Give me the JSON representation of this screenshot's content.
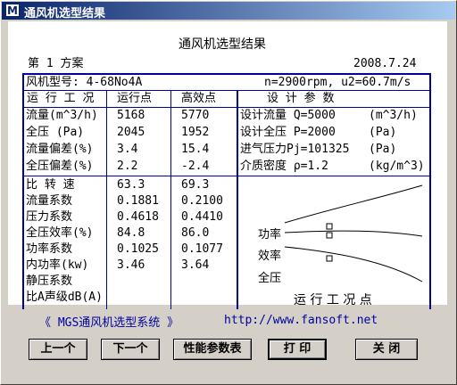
{
  "window": {
    "title": "通风机选型结果"
  },
  "report": {
    "heading": "通风机选型结果",
    "plan": "第 1 方案",
    "date": "2008.7.24",
    "fan_model": "风机型号: 4-68No4A",
    "speed_info": "n=2900rpm, u2=60.7m/s"
  },
  "table": {
    "headers": {
      "condition": "运 行 工 况",
      "operating": "运行点",
      "efficient": "高效点",
      "design": "设 计 参 数"
    },
    "rows1": [
      {
        "label": "流量(m^3/h)",
        "op": "5168",
        "eff": "5770"
      },
      {
        "label": "全压 (Pa)",
        "op": "2045",
        "eff": "1952"
      },
      {
        "label": "流量偏差(%)",
        "op": "3.4",
        "eff": "15.4"
      },
      {
        "label": "全压偏差(%)",
        "op": "2.2",
        "eff": "-2.4"
      }
    ],
    "design_params": [
      {
        "label": "设计流量 Q=5000",
        "unit": "(m^3/h)"
      },
      {
        "label": "设计全压 P=2000",
        "unit": "(Pa)"
      },
      {
        "label": "进气压力Pj=101325",
        "unit": "(Pa)"
      },
      {
        "label": "介质密度 ρ=1.2",
        "unit": "(kg/m^3)"
      }
    ],
    "rows2": [
      {
        "label": "比 转 速",
        "op": "63.3",
        "eff": "69.3"
      },
      {
        "label": "流量系数",
        "op": "0.1881",
        "eff": "0.2100"
      },
      {
        "label": "压力系数",
        "op": "0.4618",
        "eff": "0.4410"
      },
      {
        "label": "全压效率(%)",
        "op": "84.8",
        "eff": "86.0"
      },
      {
        "label": "功率系数",
        "op": "0.1025",
        "eff": "0.1077"
      },
      {
        "label": "内功率(kw)",
        "op": "3.46",
        "eff": "3.64"
      },
      {
        "label": "静压系数",
        "op": "",
        "eff": ""
      },
      {
        "label": "比A声级dB(A)",
        "op": "",
        "eff": ""
      }
    ]
  },
  "curve": {
    "labels": {
      "power": "功率",
      "efficiency": "效率",
      "pressure": "全压"
    },
    "caption": "运 行 工 况 点",
    "color": "#000000"
  },
  "footer": {
    "system": "《 MGS通风机选型系统 》",
    "url": "http://www.fansoft.net"
  },
  "buttons": {
    "prev": "上一个",
    "next": "下一个",
    "params": "性能参数表",
    "print": "打 印",
    "close": "关 闭"
  },
  "colors": {
    "frame": "#0000a0",
    "title_start": "#0a246a",
    "title_end": "#a6caf0",
    "face": "#d4d0c8"
  }
}
